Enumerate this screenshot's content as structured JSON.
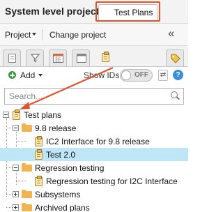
{
  "header": {
    "title": "System level project"
  },
  "toolbar": {
    "project_label": "Project",
    "change_project_label": "Change project",
    "collapse_glyph": "«"
  },
  "tabs": {
    "items": [
      {
        "icon": "document-icon"
      },
      {
        "icon": "filter-icon"
      },
      {
        "icon": "calendar-icon"
      },
      {
        "icon": "window-icon"
      },
      {
        "icon": "test-plans-icon",
        "label": "Test Plans",
        "active": true
      },
      {
        "icon": "tag-icon"
      }
    ],
    "highlight_color": "#e0532c"
  },
  "actions": {
    "add_label": "Add",
    "show_ids_label": "Show IDs",
    "toggle_state": "OFF",
    "help_glyph": "?"
  },
  "search": {
    "placeholder": "Search..."
  },
  "tree": {
    "root": "Test plans",
    "items": [
      {
        "label": "9.8 release",
        "type": "folder",
        "expanded": true
      },
      {
        "label": "IC2 Interface for 9.8 release",
        "type": "plan"
      },
      {
        "label": "Test 2.0",
        "type": "plan",
        "selected": true
      },
      {
        "label": "Regression testing",
        "type": "folder",
        "expanded": true
      },
      {
        "label": "Regression testing for I2C Interface",
        "type": "plan"
      },
      {
        "label": "Subsystems",
        "type": "folder",
        "expanded": false
      },
      {
        "label": "Archived plans",
        "type": "folder",
        "expanded": false
      }
    ]
  },
  "colors": {
    "selection": "#bfe6f6",
    "accent_add": "#2e9c3e",
    "help": "#3b8fd6",
    "annotation_arrow": "#e0532c"
  }
}
